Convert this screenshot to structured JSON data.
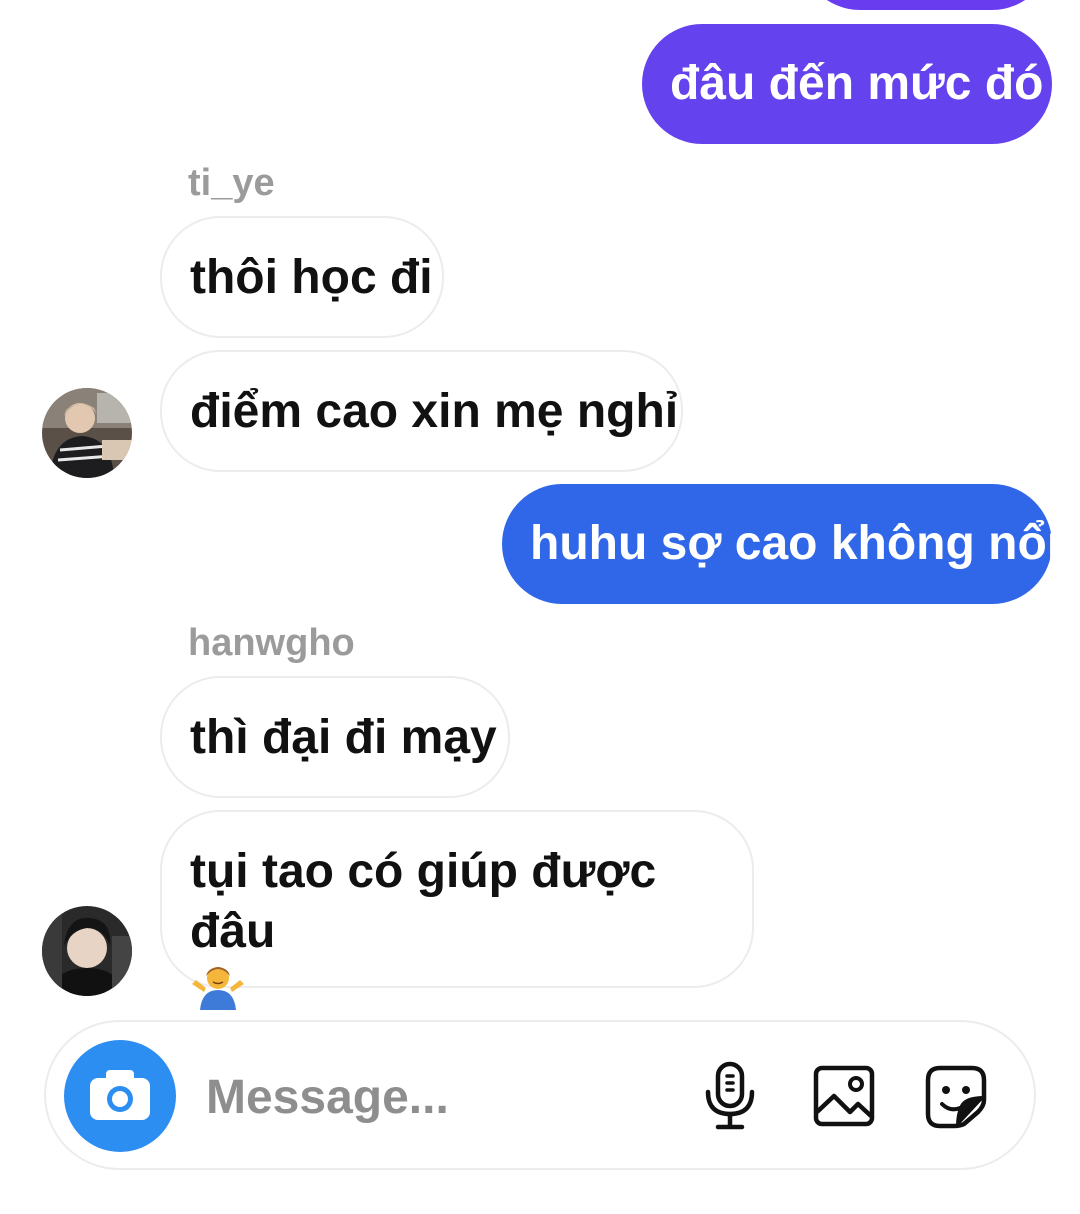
{
  "messages": [
    {
      "id": "m0",
      "direction": "out",
      "text": ""
    },
    {
      "id": "m1",
      "direction": "out",
      "text": "đâu đến mức đó"
    },
    {
      "id": "m2",
      "direction": "in",
      "sender": "ti_ye",
      "text": "thôi học đi"
    },
    {
      "id": "m3",
      "direction": "in",
      "text": "điểm cao xin mẹ nghỉ"
    },
    {
      "id": "m4",
      "direction": "out",
      "text": "huhu sợ cao không nổi"
    },
    {
      "id": "m5",
      "direction": "in",
      "sender": "hanwgho",
      "text": "thì đại đi mạy"
    },
    {
      "id": "m6",
      "direction": "in",
      "text": "tụi tao có giúp được đâu",
      "emoji": "person-shrugging"
    }
  ],
  "colors": {
    "gradient_purple": "#6541ee",
    "gradient_blue": "#2f67e8",
    "camera_blue": "#2d8ef2"
  },
  "composer": {
    "placeholder": "Message...",
    "value": "",
    "icons": [
      "camera-icon",
      "microphone-icon",
      "image-icon",
      "sticker-icon"
    ]
  }
}
